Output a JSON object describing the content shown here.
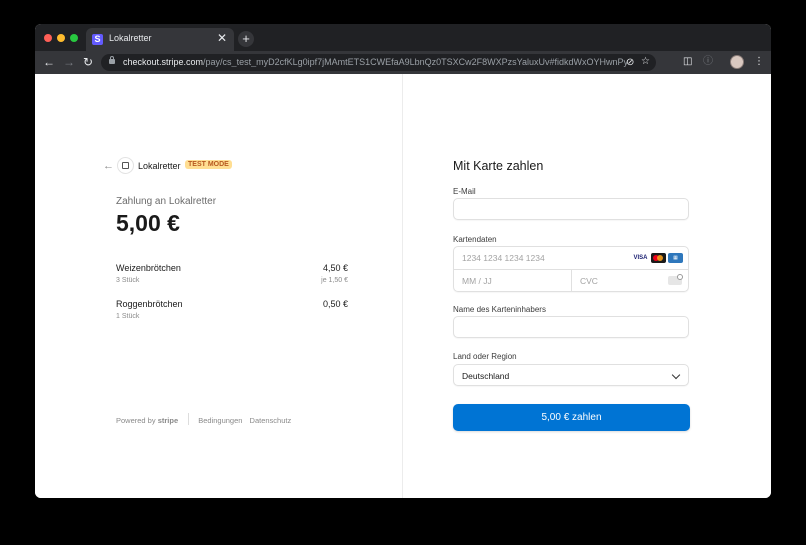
{
  "browser": {
    "tab_title": "Lokalretter",
    "tab_favicon_letter": "S",
    "new_tab_symbol": "+",
    "tab_close_symbol": "✕",
    "url_domain": "checkout.stripe.com",
    "url_path": "/pay/cs_test_myD2cfKLg0ipf7jMAmtETS1CWEfaA9LbnQz0TSXCw2F8WXPzsYaluxUv#fidkdWxOYHwnPyd1…",
    "traffic_colors": [
      "#ff5f57",
      "#febc2e",
      "#28c840"
    ]
  },
  "summary": {
    "back_symbol": "←",
    "business_name": "Lokalretter",
    "test_badge": "TEST MODE",
    "pay_to_label": "Zahlung an Lokalretter",
    "total_amount": "5,00 €",
    "items": [
      {
        "name": "Weizenbrötchen",
        "qty": "3 Stück",
        "price": "4,50 €",
        "unit_price": "je 1,50 €"
      },
      {
        "name": "Roggenbrötchen",
        "qty": "1 Stück",
        "price": "0,50 €",
        "unit_price": ""
      }
    ],
    "footer": {
      "powered_by": "Powered by",
      "stripe_word": "stripe",
      "terms": "Bedingungen",
      "privacy": "Datenschutz"
    }
  },
  "form": {
    "title": "Mit Karte zahlen",
    "email_label": "E-Mail",
    "email_value": "",
    "card_label": "Kartendaten",
    "card_number_placeholder": "1234 1234 1234 1234",
    "expiry_placeholder": "MM / JJ",
    "cvc_placeholder": "CVC",
    "card_brands": [
      "VISA",
      "mastercard",
      "amex"
    ],
    "name_label": "Name des Karteninhabers",
    "name_value": "",
    "country_label": "Land oder Region",
    "country_value": "Deutschland",
    "pay_button": "5,00 € zahlen",
    "accent_color": "#0074d4"
  }
}
